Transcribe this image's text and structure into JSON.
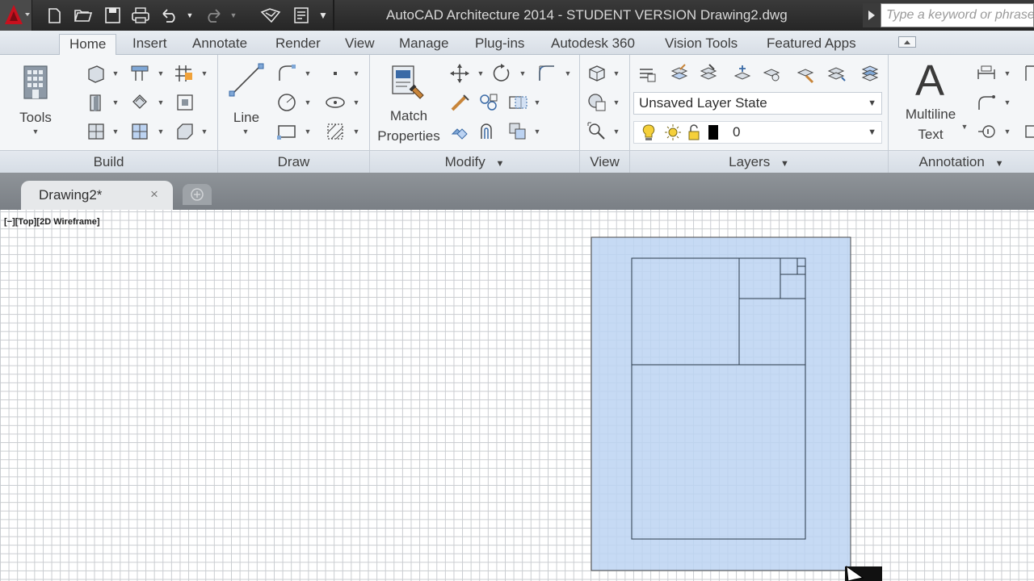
{
  "title_bar": {
    "title": "AutoCAD Architecture 2014 - STUDENT VERSION     Drawing2.dwg",
    "search_placeholder": "Type a keyword or phrase",
    "app_button_letter": "A"
  },
  "ribbon_tabs": [
    {
      "label": "Home"
    },
    {
      "label": "Insert"
    },
    {
      "label": "Annotate"
    },
    {
      "label": "Render"
    },
    {
      "label": "View"
    },
    {
      "label": "Manage"
    },
    {
      "label": "Plug-ins"
    },
    {
      "label": "Autodesk 360"
    },
    {
      "label": "Vision Tools"
    },
    {
      "label": "Featured Apps"
    }
  ],
  "panels": {
    "build": {
      "title": "Build",
      "tools_label": "Tools"
    },
    "draw": {
      "title": "Draw",
      "line_label": "Line"
    },
    "modify": {
      "title": "Modify",
      "match_line1": "Match",
      "match_line2": "Properties"
    },
    "view": {
      "title": "View"
    },
    "layers": {
      "title": "Layers",
      "layer_state": "Unsaved Layer State",
      "current_layer": "0"
    },
    "annotation": {
      "title": "Annotation",
      "mtext_line1": "Multiline",
      "mtext_line2": "Text",
      "mtext_glyph": "A"
    }
  },
  "document": {
    "tab_label": "Drawing2*",
    "close_glyph": "×",
    "viewport_label": "[−][Top][2D Wireframe]"
  },
  "colors": {
    "app_red": "#c8101e",
    "selection_fill": "#bcd3f2",
    "tab_active_bg": "#f4f6f8"
  }
}
